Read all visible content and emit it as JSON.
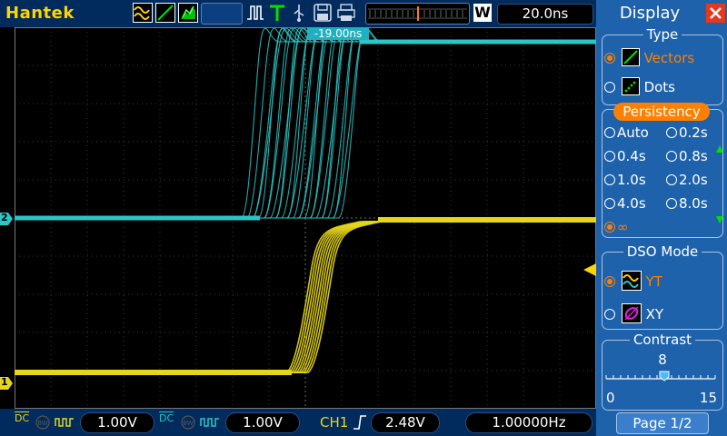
{
  "header": {
    "brand": "Hantek",
    "timebase": "20.0ns",
    "time_mode_letter": "W"
  },
  "screen": {
    "trigger_time_label": "-19.00ns",
    "ch2_marker": "2",
    "ch1_marker": "1"
  },
  "footer": {
    "ch1_coupling": "DC",
    "ch1_volts": "1.00V",
    "ch2_coupling": "DC",
    "ch2_volts": "1.00V",
    "trigger_source": "CH1",
    "trigger_level": "2.48V",
    "frequency": "1.00000Hz"
  },
  "panel": {
    "title": "Display",
    "type_label": "Type",
    "type_options": [
      "Vectors",
      "Dots"
    ],
    "type_selected": "Vectors",
    "persistency_label": "Persistency",
    "persistency_options": [
      "Auto",
      "0.2s",
      "0.4s",
      "0.8s",
      "1.0s",
      "2.0s",
      "4.0s",
      "8.0s",
      "∞"
    ],
    "persistency_selected": "∞",
    "dso_mode_label": "DSO Mode",
    "dso_mode_options": [
      "YT",
      "XY"
    ],
    "dso_mode_selected": "YT",
    "contrast_label": "Contrast",
    "contrast_value": "8",
    "contrast_min": "0",
    "contrast_max": "15",
    "page_label": "Page 1/2"
  },
  "colors": {
    "ch1": "#e6d619",
    "ch2": "#29c7c7",
    "highlight": "#ff8000",
    "panel_bg": "#1e62ac",
    "bar_bg": "#002b5c"
  }
}
